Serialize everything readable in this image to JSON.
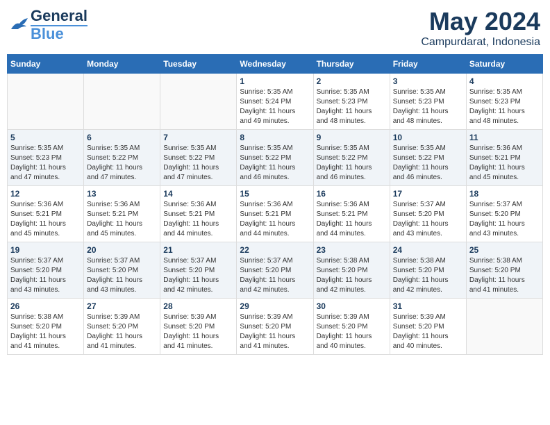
{
  "header": {
    "logo_line1": "General",
    "logo_line2": "Blue",
    "title": "May 2024",
    "subtitle": "Campurdarat, Indonesia"
  },
  "days_of_week": [
    "Sunday",
    "Monday",
    "Tuesday",
    "Wednesday",
    "Thursday",
    "Friday",
    "Saturday"
  ],
  "weeks": [
    [
      {
        "day": "",
        "info": ""
      },
      {
        "day": "",
        "info": ""
      },
      {
        "day": "",
        "info": ""
      },
      {
        "day": "1",
        "info": "Sunrise: 5:35 AM\nSunset: 5:24 PM\nDaylight: 11 hours\nand 49 minutes."
      },
      {
        "day": "2",
        "info": "Sunrise: 5:35 AM\nSunset: 5:23 PM\nDaylight: 11 hours\nand 48 minutes."
      },
      {
        "day": "3",
        "info": "Sunrise: 5:35 AM\nSunset: 5:23 PM\nDaylight: 11 hours\nand 48 minutes."
      },
      {
        "day": "4",
        "info": "Sunrise: 5:35 AM\nSunset: 5:23 PM\nDaylight: 11 hours\nand 48 minutes."
      }
    ],
    [
      {
        "day": "5",
        "info": "Sunrise: 5:35 AM\nSunset: 5:23 PM\nDaylight: 11 hours\nand 47 minutes."
      },
      {
        "day": "6",
        "info": "Sunrise: 5:35 AM\nSunset: 5:22 PM\nDaylight: 11 hours\nand 47 minutes."
      },
      {
        "day": "7",
        "info": "Sunrise: 5:35 AM\nSunset: 5:22 PM\nDaylight: 11 hours\nand 47 minutes."
      },
      {
        "day": "8",
        "info": "Sunrise: 5:35 AM\nSunset: 5:22 PM\nDaylight: 11 hours\nand 46 minutes."
      },
      {
        "day": "9",
        "info": "Sunrise: 5:35 AM\nSunset: 5:22 PM\nDaylight: 11 hours\nand 46 minutes."
      },
      {
        "day": "10",
        "info": "Sunrise: 5:35 AM\nSunset: 5:22 PM\nDaylight: 11 hours\nand 46 minutes."
      },
      {
        "day": "11",
        "info": "Sunrise: 5:36 AM\nSunset: 5:21 PM\nDaylight: 11 hours\nand 45 minutes."
      }
    ],
    [
      {
        "day": "12",
        "info": "Sunrise: 5:36 AM\nSunset: 5:21 PM\nDaylight: 11 hours\nand 45 minutes."
      },
      {
        "day": "13",
        "info": "Sunrise: 5:36 AM\nSunset: 5:21 PM\nDaylight: 11 hours\nand 45 minutes."
      },
      {
        "day": "14",
        "info": "Sunrise: 5:36 AM\nSunset: 5:21 PM\nDaylight: 11 hours\nand 44 minutes."
      },
      {
        "day": "15",
        "info": "Sunrise: 5:36 AM\nSunset: 5:21 PM\nDaylight: 11 hours\nand 44 minutes."
      },
      {
        "day": "16",
        "info": "Sunrise: 5:36 AM\nSunset: 5:21 PM\nDaylight: 11 hours\nand 44 minutes."
      },
      {
        "day": "17",
        "info": "Sunrise: 5:37 AM\nSunset: 5:20 PM\nDaylight: 11 hours\nand 43 minutes."
      },
      {
        "day": "18",
        "info": "Sunrise: 5:37 AM\nSunset: 5:20 PM\nDaylight: 11 hours\nand 43 minutes."
      }
    ],
    [
      {
        "day": "19",
        "info": "Sunrise: 5:37 AM\nSunset: 5:20 PM\nDaylight: 11 hours\nand 43 minutes."
      },
      {
        "day": "20",
        "info": "Sunrise: 5:37 AM\nSunset: 5:20 PM\nDaylight: 11 hours\nand 43 minutes."
      },
      {
        "day": "21",
        "info": "Sunrise: 5:37 AM\nSunset: 5:20 PM\nDaylight: 11 hours\nand 42 minutes."
      },
      {
        "day": "22",
        "info": "Sunrise: 5:37 AM\nSunset: 5:20 PM\nDaylight: 11 hours\nand 42 minutes."
      },
      {
        "day": "23",
        "info": "Sunrise: 5:38 AM\nSunset: 5:20 PM\nDaylight: 11 hours\nand 42 minutes."
      },
      {
        "day": "24",
        "info": "Sunrise: 5:38 AM\nSunset: 5:20 PM\nDaylight: 11 hours\nand 42 minutes."
      },
      {
        "day": "25",
        "info": "Sunrise: 5:38 AM\nSunset: 5:20 PM\nDaylight: 11 hours\nand 41 minutes."
      }
    ],
    [
      {
        "day": "26",
        "info": "Sunrise: 5:38 AM\nSunset: 5:20 PM\nDaylight: 11 hours\nand 41 minutes."
      },
      {
        "day": "27",
        "info": "Sunrise: 5:39 AM\nSunset: 5:20 PM\nDaylight: 11 hours\nand 41 minutes."
      },
      {
        "day": "28",
        "info": "Sunrise: 5:39 AM\nSunset: 5:20 PM\nDaylight: 11 hours\nand 41 minutes."
      },
      {
        "day": "29",
        "info": "Sunrise: 5:39 AM\nSunset: 5:20 PM\nDaylight: 11 hours\nand 41 minutes."
      },
      {
        "day": "30",
        "info": "Sunrise: 5:39 AM\nSunset: 5:20 PM\nDaylight: 11 hours\nand 40 minutes."
      },
      {
        "day": "31",
        "info": "Sunrise: 5:39 AM\nSunset: 5:20 PM\nDaylight: 11 hours\nand 40 minutes."
      },
      {
        "day": "",
        "info": ""
      }
    ]
  ]
}
